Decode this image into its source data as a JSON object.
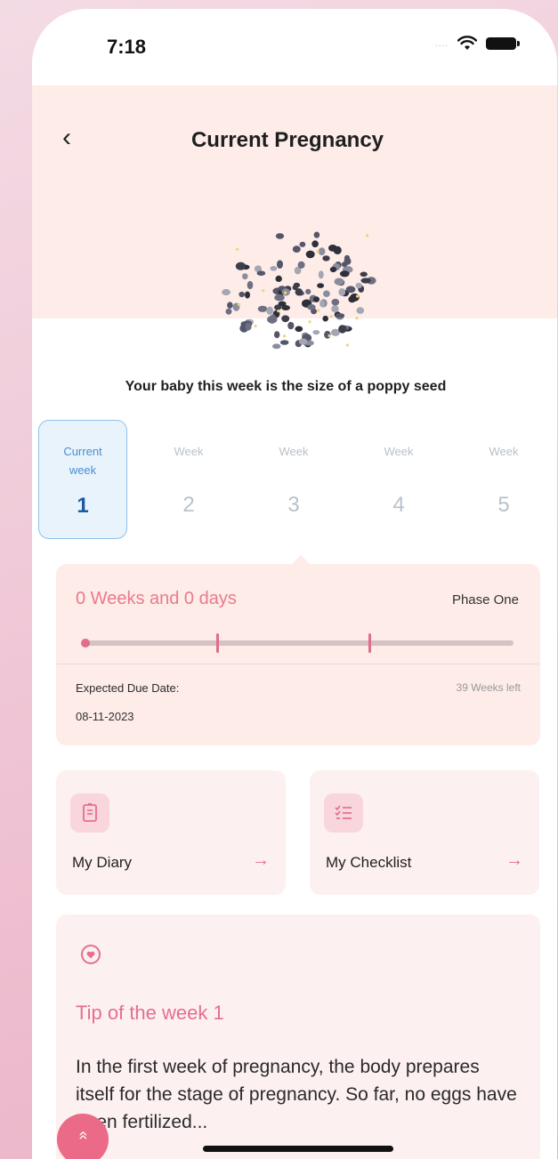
{
  "status_bar": {
    "time": "7:18",
    "signal": "....",
    "wifi_icon": "wifi-icon",
    "battery_icon": "battery-icon"
  },
  "header": {
    "back_icon": "chevron-left-icon",
    "back_glyph": "‹",
    "title": "Current Pregnancy"
  },
  "hero": {
    "illustration": "poppy-seed-illustration",
    "size_text": "Your baby this week is the size of a poppy seed"
  },
  "weeks": [
    {
      "label": "Current week",
      "number": "1",
      "active": true
    },
    {
      "label": "Week",
      "number": "2",
      "active": false
    },
    {
      "label": "Week",
      "number": "3",
      "active": false
    },
    {
      "label": "Week",
      "number": "4",
      "active": false
    },
    {
      "label": "Week",
      "number": "5",
      "active": false
    }
  ],
  "progress": {
    "elapsed": "0 Weeks and 0 days",
    "phase": "Phase One",
    "fraction_complete": 0.0,
    "due_label": "Expected Due Date:",
    "due_date": "08-11-2023",
    "weeks_left": "39 Weeks left"
  },
  "actions": [
    {
      "label": "My Diary",
      "icon": "diary-icon",
      "arrow": "→"
    },
    {
      "label": "My Checklist",
      "icon": "checklist-icon",
      "arrow": "→"
    }
  ],
  "tip": {
    "icon": "heart-icon",
    "title": "Tip of the week 1",
    "body": "In the first week of pregnancy, the body prepares itself for the stage of pregnancy. So far, no eggs have been fertilized..."
  },
  "fab": {
    "icon": "chevron-up-icon",
    "glyph": "»"
  },
  "colors": {
    "accent": "#e56f8c",
    "header_bg": "#fdece8",
    "card_bg": "#fdf0f1",
    "week_active": "#1c5aa3"
  }
}
